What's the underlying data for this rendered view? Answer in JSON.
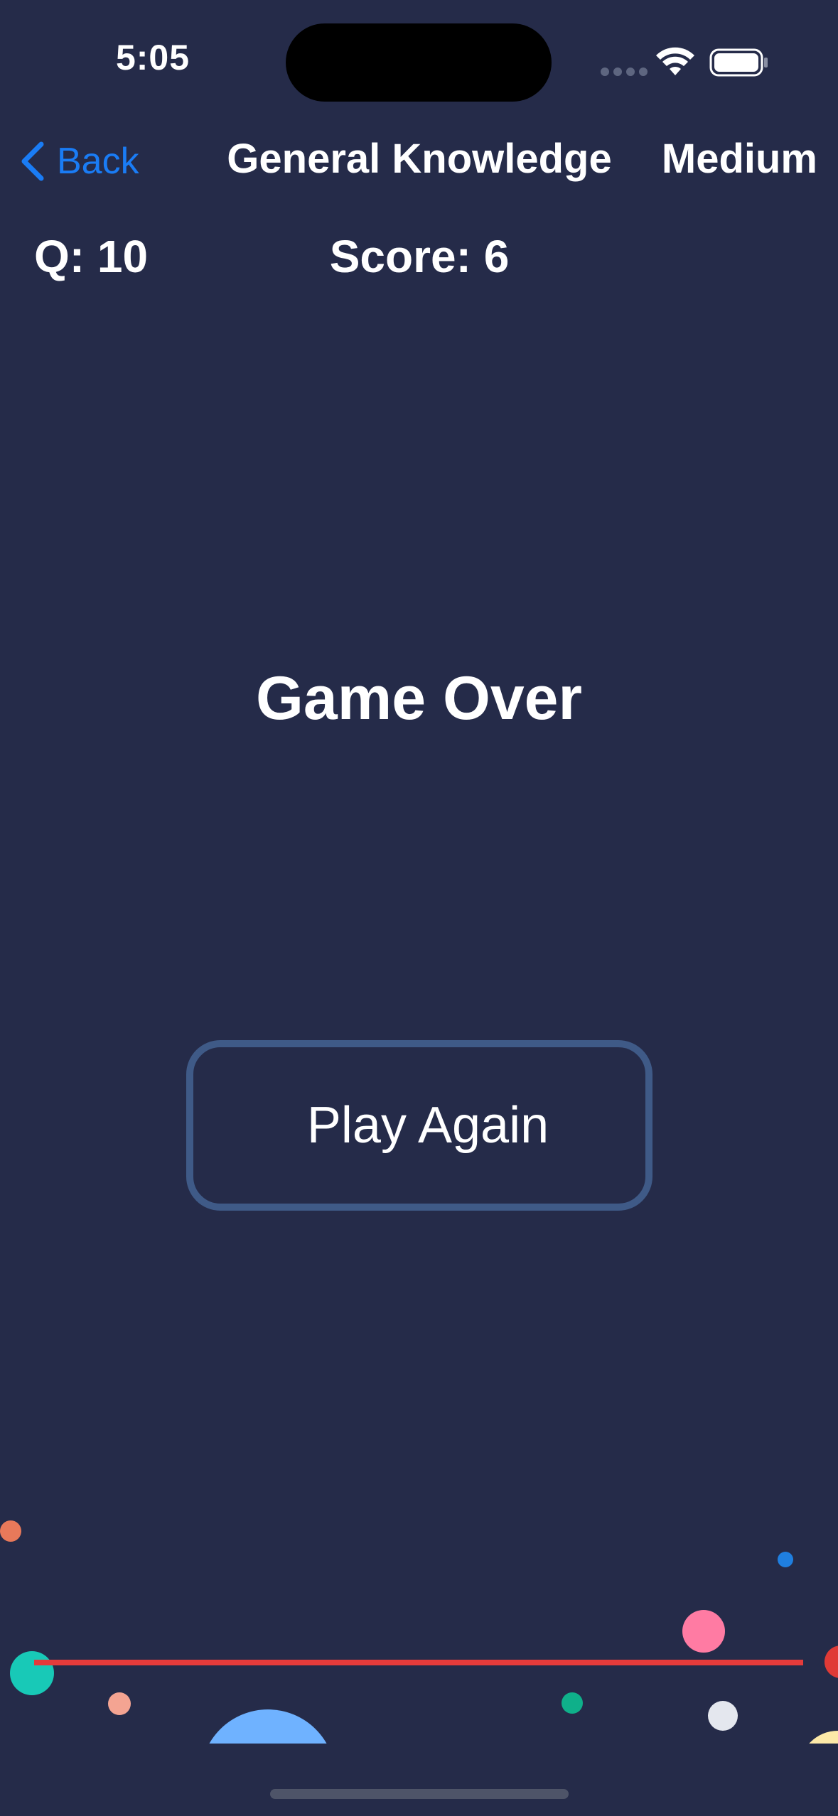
{
  "status_bar": {
    "time": "5:05"
  },
  "nav": {
    "back_label": "Back",
    "title": "General Knowledge",
    "difficulty": "Medium"
  },
  "game": {
    "question_label": "Q: 10",
    "score_label": "Score: 6",
    "result_text": "Game Over",
    "play_again_label": "Play Again"
  },
  "colors": {
    "background": "#252b49",
    "accent": "#1a7cf5",
    "button_border": "#3f5a87",
    "line": "#e53b3b"
  }
}
